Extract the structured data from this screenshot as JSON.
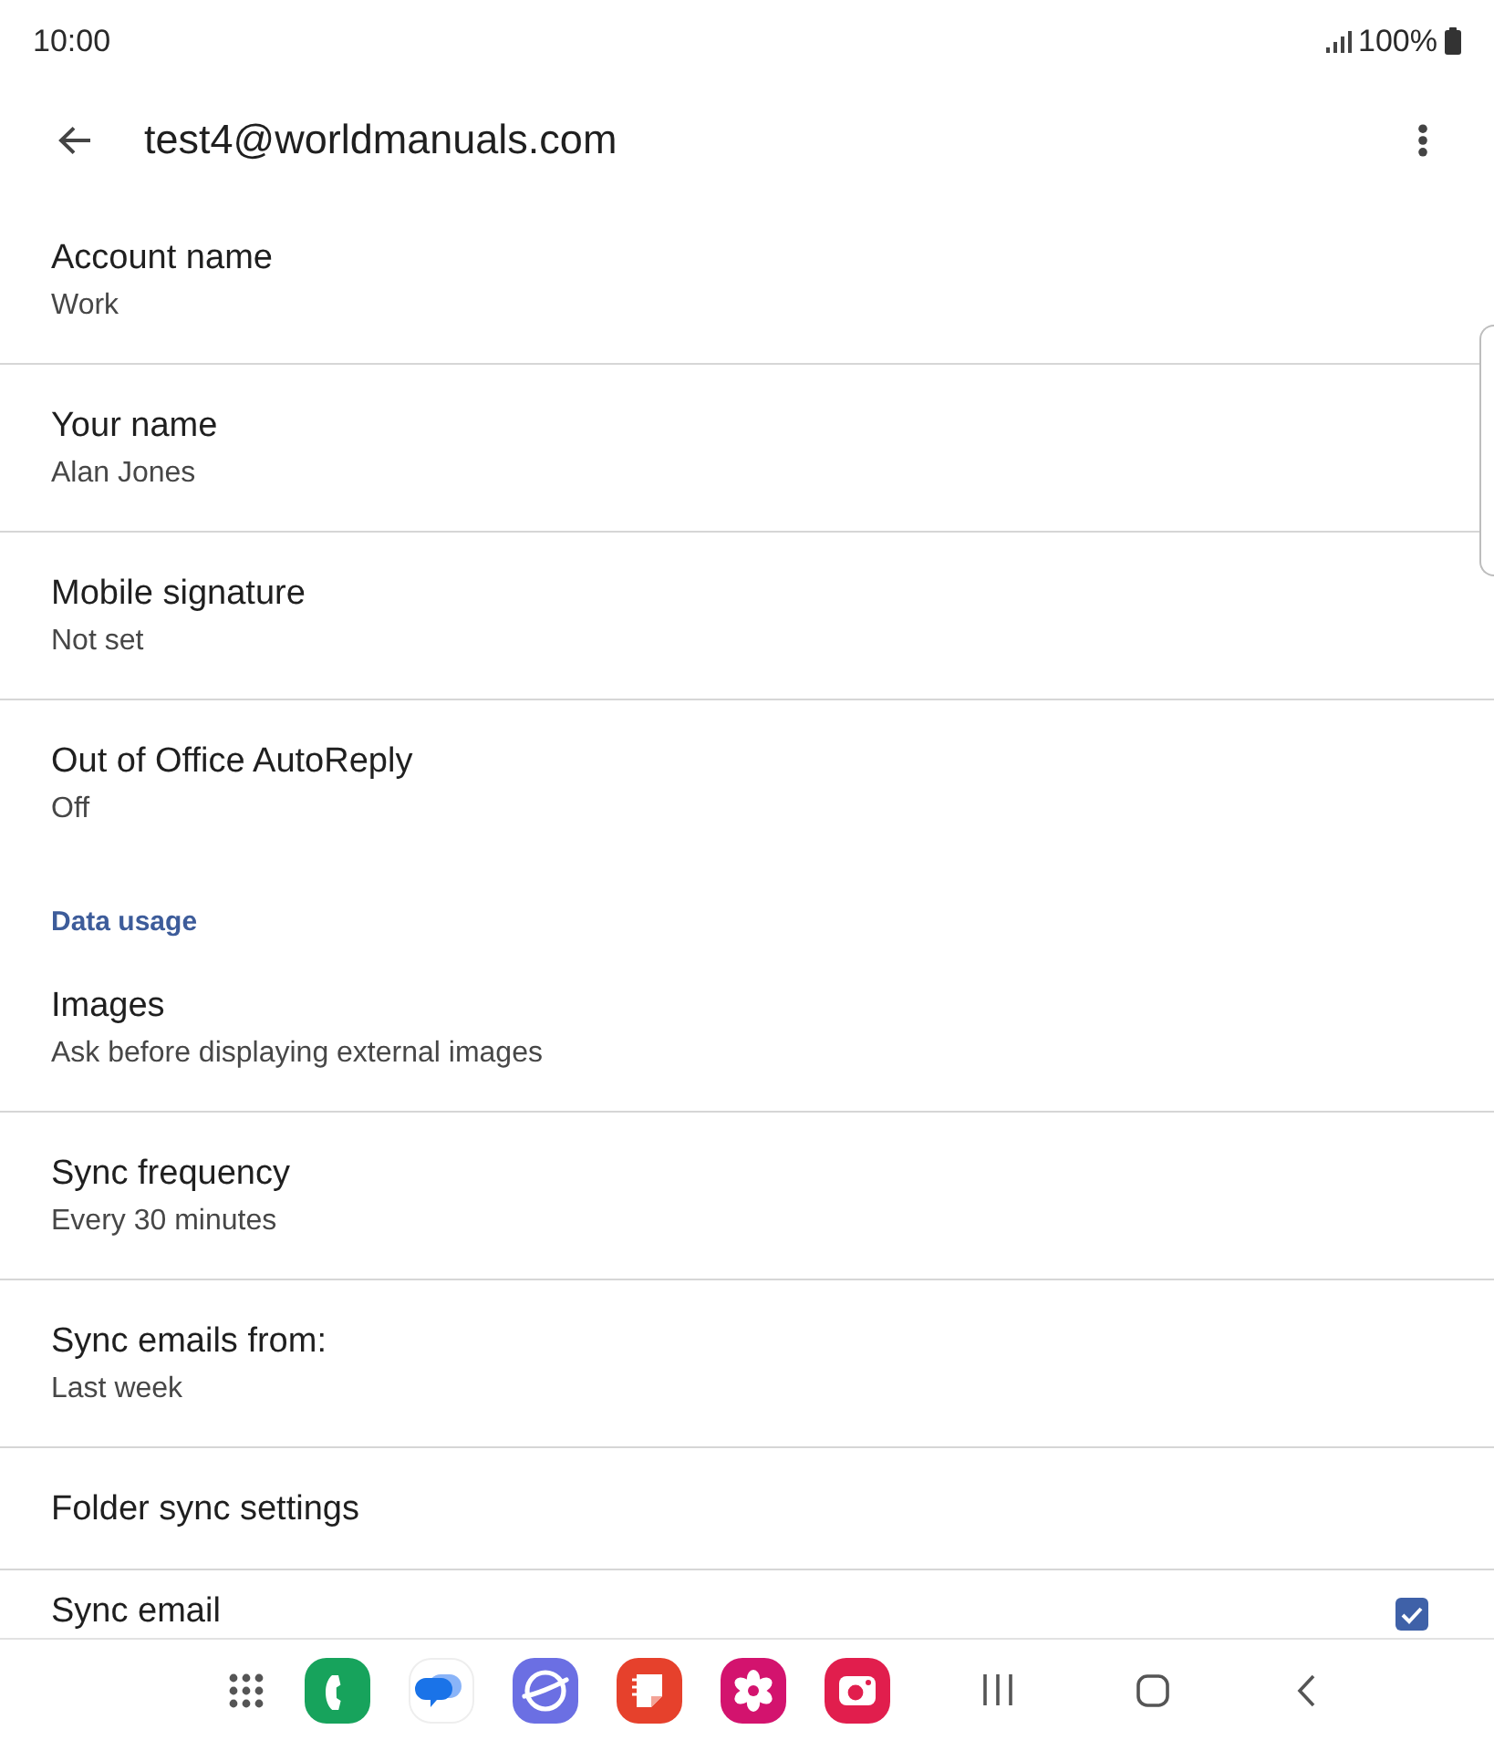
{
  "status_bar": {
    "time": "10:00",
    "battery": "100%"
  },
  "app_bar": {
    "title": "test4@worldmanuals.com"
  },
  "settings": [
    {
      "kind": "setting",
      "title": "Account name",
      "summary": "Work"
    },
    {
      "kind": "setting",
      "title": "Your name",
      "summary": "Alan Jones"
    },
    {
      "kind": "setting",
      "title": "Mobile signature",
      "summary": "Not set"
    },
    {
      "kind": "setting",
      "title": "Out of Office AutoReply",
      "summary": "Off"
    },
    {
      "kind": "header",
      "title": "Data usage"
    },
    {
      "kind": "setting",
      "title": "Images",
      "summary": "Ask before displaying external images"
    },
    {
      "kind": "setting",
      "title": "Sync frequency",
      "summary": "Every 30 minutes"
    },
    {
      "kind": "setting",
      "title": "Sync emails from:",
      "summary": "Last week"
    },
    {
      "kind": "setting",
      "title": "Folder sync settings"
    },
    {
      "kind": "checkbox",
      "title": "Sync email",
      "checked": true
    }
  ]
}
